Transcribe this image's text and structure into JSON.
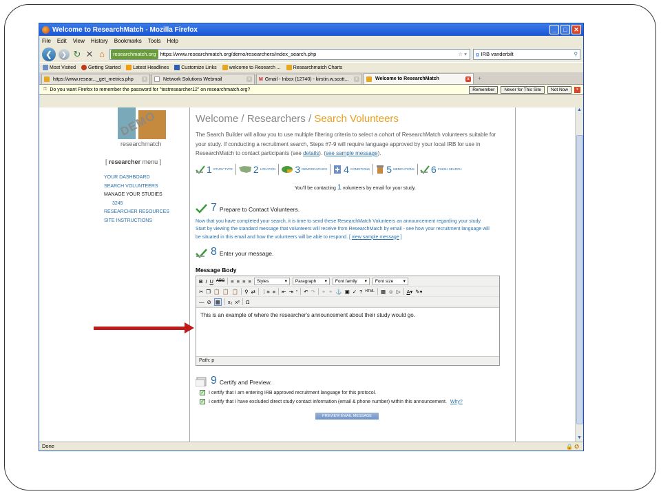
{
  "window": {
    "title": "Welcome to ResearchMatch - Mozilla Firefox",
    "controls": [
      "_",
      "□",
      "✕"
    ]
  },
  "menu": [
    "File",
    "Edit",
    "View",
    "History",
    "Bookmarks",
    "Tools",
    "Help"
  ],
  "nav": {
    "site_badge": "researchmatch.org",
    "url": "https://www.researchmatch.org/demo/researchers/index_search.php",
    "search_value": "IRB vanderbilt"
  },
  "bookmarks": [
    "Most Visited",
    "Getting Started",
    "Latest Headlines",
    "Customize Links",
    "welcome to Research ...",
    "Researchmatch Charts"
  ],
  "tabs": [
    {
      "label": "https://www.resear..._get_metrics.php"
    },
    {
      "label": "Network Solutions Webmail"
    },
    {
      "label": "Gmail - Inbox (12740) - kirstin.w.scott..."
    },
    {
      "label": "Welcome to ResearchMatch"
    }
  ],
  "notification": {
    "text": "Do you want Firefox to remember the password for \"testresearcher12\" on researchmatch.org?",
    "remember": "Remember",
    "never": "Never for This Site",
    "not_now": "Not Now"
  },
  "sidebar": {
    "logo_demo": "DEMO",
    "logo_word": "researchmatch",
    "menu_bracket_open": "[",
    "menu_bold": "researcher",
    "menu_rest": " menu",
    "menu_bracket_close": "]",
    "links": [
      {
        "label": "YOUR DASHBOARD"
      },
      {
        "label": "SEARCH VOLUNTEERS"
      },
      {
        "label": "MANAGE YOUR STUDIES"
      },
      {
        "label": "3245"
      },
      {
        "label": "RESEARCHER RESOURCES"
      },
      {
        "label": "SITE INSTRUCTIONS"
      }
    ]
  },
  "main": {
    "crumb_1": "Welcome",
    "crumb_sep": " / ",
    "crumb_2": "Researchers",
    "crumb_3": "Search Volunteers",
    "intro_1": "The Search Builder will allow you to use multiple filtering criteria to select a cohort of ResearchMatch volunteers suitable for your study. If conducting a recruitment search, Steps #7-9 will require language approved by your local IRB for use in ResearchMatch to contact participants (see ",
    "intro_link1": "details",
    "intro_2": "). (",
    "intro_link2": "see sample message",
    "intro_3": ").",
    "steps": [
      {
        "num": "1",
        "label": "STUDY TYPE"
      },
      {
        "num": "2",
        "label": "LOCATION"
      },
      {
        "num": "3",
        "label": "DEMOGRAPHICS"
      },
      {
        "num": "4",
        "label": "CONDITIONS"
      },
      {
        "num": "5",
        "label": "MEDICATIONS"
      },
      {
        "num": "6",
        "label": "FINISH SEARCH"
      }
    ],
    "contact_pre": "You'll be contacting ",
    "contact_n": "1",
    "contact_post": " volunteers by email for your study.",
    "s7_num": "7",
    "s7_title": "Prepare to Contact Volunteers.",
    "s7_text": "Now that you have completed your search, it is time to send these ResearchMatch Volunteers an announcement regarding your study.  Start by viewing the standard message that volunteers will receive from ResearchMatch by email - see how your recruitment language will be situated in this email and how the volunteers will be able to respond. [ ",
    "s7_link": "view sample message",
    "s7_end": " ]",
    "s8_num": "8",
    "s8_title": "Enter your message.",
    "message_body_label": "Message Body",
    "editor": {
      "styles": "Styles",
      "paragraph": "Paragraph",
      "font_family": "Font family",
      "font_size": "Font size",
      "text": "This is an example of where the researcher's announcement about their study would go.",
      "path": "Path: p"
    },
    "s9_num": "9",
    "s9_title": "Certify and Preview.",
    "cert1": "I certify that I am entering IRB approved recruitment language for this protocol.",
    "cert2": "I certify that I have excluded direct study contact information (email & phone number) within this announcement.",
    "cert2_link": "Why?",
    "preview_button": "PREVIEW EMAIL MESSAGE"
  },
  "status": "Done"
}
